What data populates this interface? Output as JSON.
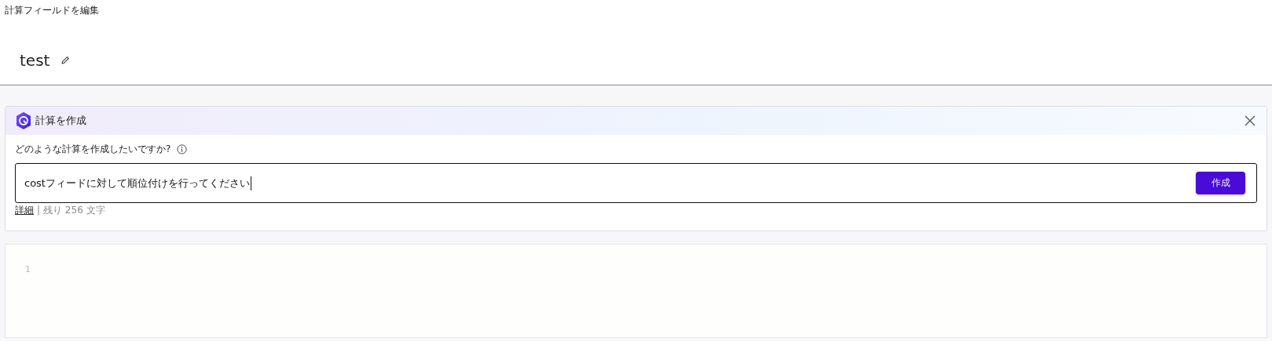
{
  "page_title": "計算フィールドを編集",
  "field_name": "test",
  "assistant": {
    "title": "計算を作成",
    "question": "どのような計算を作成したいですか?",
    "prompt_value": "costフィードに対して順位付けを行ってください",
    "submit_label": "作成",
    "details_link": "詳細",
    "separator": "|",
    "remaining": "残り 256 文字"
  },
  "editor": {
    "line_numbers": [
      "1"
    ]
  }
}
